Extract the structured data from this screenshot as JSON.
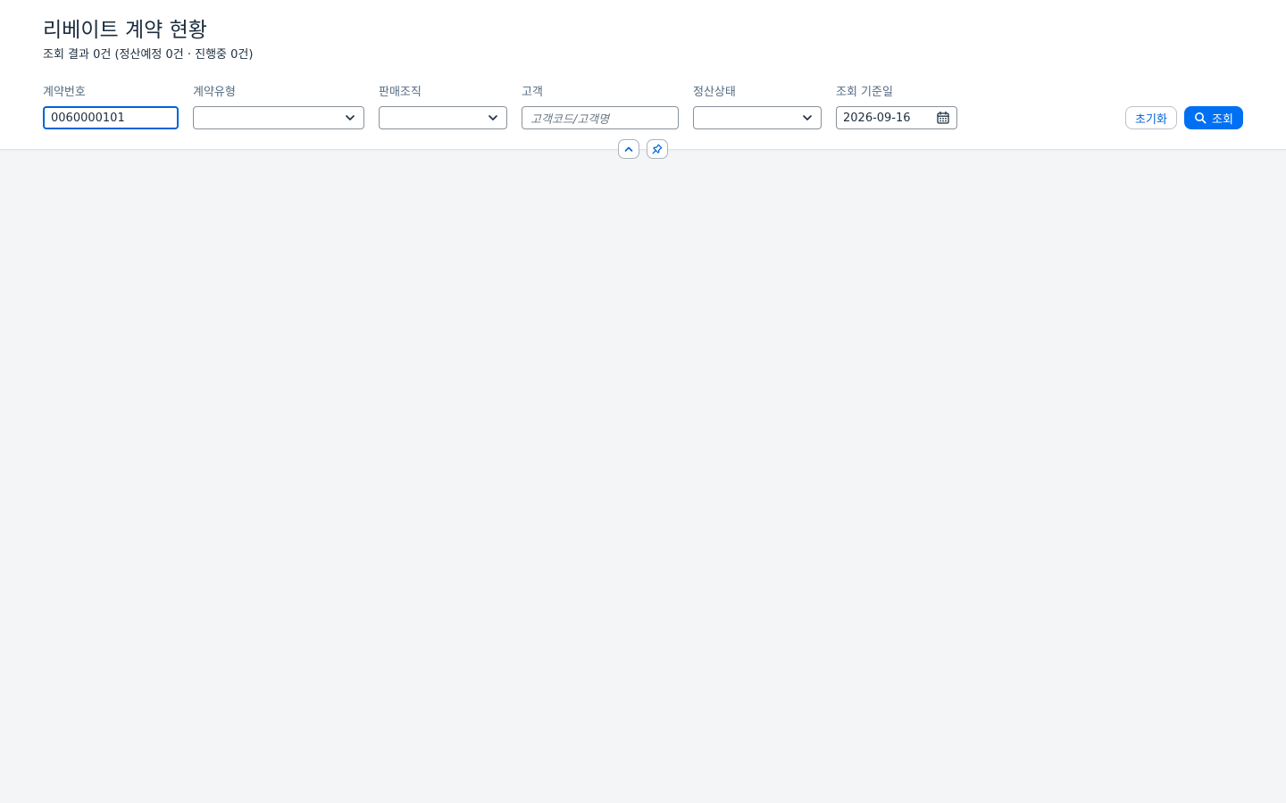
{
  "page": {
    "title": "리베이트 계약 현황",
    "summary": "조회 결과 0건 (정산예정 0건 · 진행중 0건)"
  },
  "filters": {
    "contract_no": {
      "label": "계약번호",
      "value": "0060000101"
    },
    "contract_type": {
      "label": "계약유형",
      "value": ""
    },
    "sales_org": {
      "label": "판매조직",
      "value": ""
    },
    "customer": {
      "label": "고객",
      "value": "",
      "placeholder": "고객코드/고객명"
    },
    "settlement_status": {
      "label": "정산상태",
      "value": ""
    },
    "base_date": {
      "label": "조회 기준일",
      "value": "2026-09-16"
    }
  },
  "actions": {
    "reset_label": "초기화",
    "search_label": "조회"
  },
  "icons": {
    "dropdown": "chevron-down-icon",
    "calendar": "calendar-icon",
    "search": "search-icon",
    "collapse": "chevron-up-icon",
    "pin": "pin-icon"
  },
  "colors": {
    "accent": "#0070f2",
    "focus_border": "#0064d9",
    "background": "#f4f5f7",
    "header_bg": "#ffffff"
  }
}
